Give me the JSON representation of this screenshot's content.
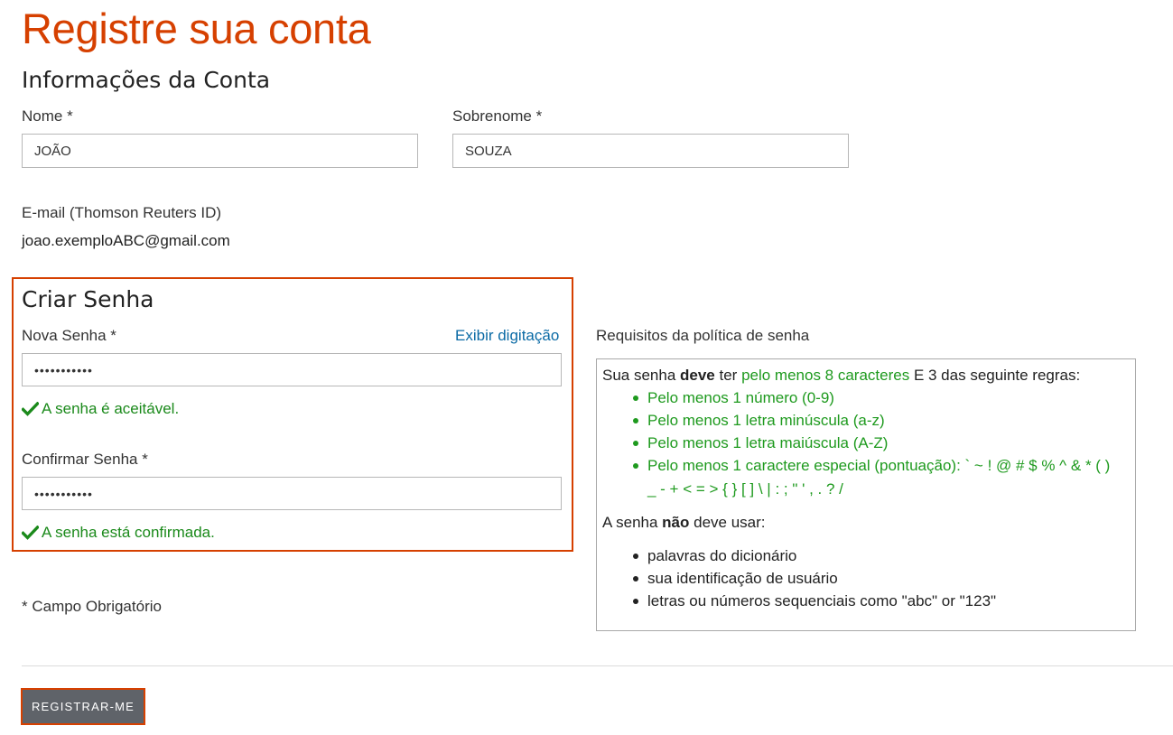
{
  "page": {
    "title": "Registre sua conta"
  },
  "account": {
    "heading": "Informações da Conta",
    "first_name": {
      "label": "Nome *",
      "value": "JOÃO"
    },
    "last_name": {
      "label": "Sobrenome *",
      "value": "SOUZA"
    },
    "email": {
      "label": "E-mail (Thomson Reuters ID)",
      "value": "joao.exemploABC@gmail.com"
    }
  },
  "password": {
    "heading": "Criar Senha",
    "new": {
      "label": "Nova Senha *",
      "value": "•••••••••••",
      "status": "A senha é aceitável."
    },
    "show_typing_link": "Exibir digitação",
    "confirm": {
      "label": "Confirmar Senha *",
      "value": "•••••••••••",
      "status": "A senha está confirmada."
    }
  },
  "required_note": "* Campo Obrigatório",
  "policy": {
    "heading": "Requisitos da política de senha",
    "intro": {
      "part1": "Sua senha ",
      "bold": "deve",
      "part2": " ter ",
      "green": "pelo menos 8 caracteres",
      "part3": " E 3 das seguinte regras:"
    },
    "rules": [
      "Pelo menos 1 número (0-9)",
      "Pelo menos 1 letra minúscula (a-z)",
      "Pelo menos 1 letra maiúscula (A-Z)",
      "Pelo menos 1 caractere especial (pontuação): ` ~ ! @ # $ % ^ & * ( )"
    ],
    "rules_continuation": "_ - + < = > { } [ ] \\ | : ; \" ' , . ? /",
    "must_not": {
      "part1": "A senha ",
      "bold": "não",
      "part2": " deve usar:"
    },
    "forbidden": [
      "palavras do dicionário",
      "sua identificação de usuário",
      "letras ou números sequenciais como \"abc\" or \"123\""
    ]
  },
  "submit_label": "REGISTRAR-ME",
  "colors": {
    "accent": "#d64000",
    "success": "#1b8a1b",
    "link": "#0a6aa5",
    "button": "#5f6369"
  },
  "icons": {
    "success": "checkmark-icon"
  }
}
